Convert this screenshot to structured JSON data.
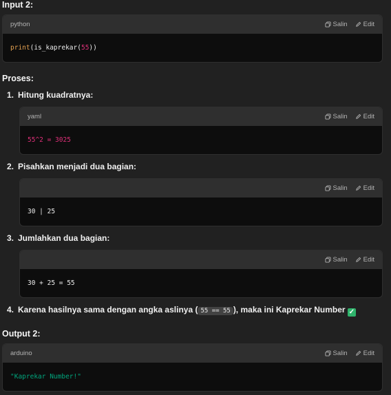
{
  "input_heading": "Input 2:",
  "input_code": {
    "lang": "python",
    "copy": "Salin",
    "edit": "Edit",
    "fn": "print",
    "mid": "(is_kaprekar(",
    "arg": "55",
    "end": "))"
  },
  "process_heading": "Proses:",
  "steps": [
    {
      "num": "1.",
      "text": "Hitung kuadratnya:",
      "lang": "yaml",
      "code": "55^2 = 3025"
    },
    {
      "num": "2.",
      "text": "Pisahkan menjadi dua bagian:",
      "lang": "",
      "code": "30 | 25"
    },
    {
      "num": "3.",
      "text": "Jumlahkan dua bagian:",
      "lang": "",
      "code": "30 + 25 = 55"
    }
  ],
  "step4": {
    "num": "4.",
    "pre": "Karena hasilnya sama dengan angka aslinya (",
    "code": "55 == 55",
    "post": "), maka ini Kaprekar Number",
    "check": "✓"
  },
  "output_heading": "Output 2:",
  "output_code": {
    "lang": "arduino",
    "code": "\"Kaprekar Number!\""
  },
  "actions": {
    "copy": "Salin",
    "edit": "Edit"
  },
  "colors": {
    "keyword": "#e5a150",
    "number": "#df3079",
    "string": "#00a67d",
    "check": "#2fb36b"
  }
}
